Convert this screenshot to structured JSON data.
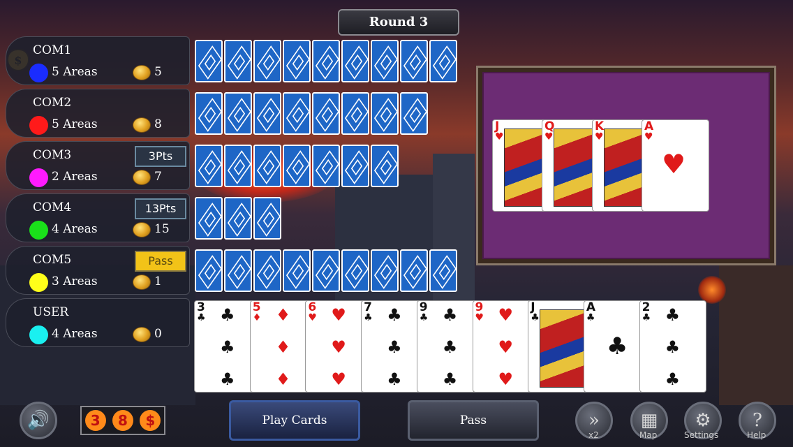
{
  "round": {
    "label": "Round 3"
  },
  "players": [
    {
      "name": "COM1",
      "areas": "5 Areas",
      "coins": "5",
      "dot_color": "#1a2cff",
      "badge": "",
      "cards": 9
    },
    {
      "name": "COM2",
      "areas": "5 Areas",
      "coins": "8",
      "dot_color": "#ff1a1a",
      "badge": "",
      "cards": 8
    },
    {
      "name": "COM3",
      "areas": "2 Areas",
      "coins": "7",
      "dot_color": "#ff1aff",
      "badge": "3Pts",
      "cards": 7
    },
    {
      "name": "COM4",
      "areas": "4 Areas",
      "coins": "15",
      "dot_color": "#1ae01a",
      "badge": "13Pts",
      "cards": 3
    },
    {
      "name": "COM5",
      "areas": "3 Areas",
      "coins": "1",
      "dot_color": "#ffff1a",
      "badge": "Pass",
      "cards": 9
    },
    {
      "name": "USER",
      "areas": "4 Areas",
      "coins": "0",
      "dot_color": "#1af0f0",
      "badge": "",
      "cards": 0
    }
  ],
  "trick": [
    {
      "rank": "J",
      "suit": "♥",
      "color": "red",
      "face": true
    },
    {
      "rank": "Q",
      "suit": "♥",
      "color": "red",
      "face": true
    },
    {
      "rank": "K",
      "suit": "♥",
      "color": "red",
      "face": true
    },
    {
      "rank": "A",
      "suit": "♥",
      "color": "red",
      "face": false
    }
  ],
  "hand": [
    {
      "rank": "3",
      "suit": "♣",
      "color": "blk"
    },
    {
      "rank": "5",
      "suit": "♦",
      "color": "red"
    },
    {
      "rank": "6",
      "suit": "♥",
      "color": "red"
    },
    {
      "rank": "7",
      "suit": "♣",
      "color": "blk"
    },
    {
      "rank": "9",
      "suit": "♣",
      "color": "blk"
    },
    {
      "rank": "9",
      "suit": "♥",
      "color": "red"
    },
    {
      "rank": "J",
      "suit": "♣",
      "color": "blk"
    },
    {
      "rank": "A",
      "suit": "♣",
      "color": "blk"
    },
    {
      "rank": "2",
      "suit": "♣",
      "color": "blk"
    }
  ],
  "controls": {
    "play_label": "Play Cards",
    "pass_label": "Pass",
    "speed_label": "x2",
    "map_label": "Map",
    "settings_label": "Settings",
    "help_label": "Help",
    "stats": [
      "3",
      "8",
      "$"
    ]
  },
  "icons": [
    "speaker-icon",
    "money-bag-icon",
    "fast-forward-icon",
    "map-icon",
    "gear-icon",
    "help-icon"
  ]
}
